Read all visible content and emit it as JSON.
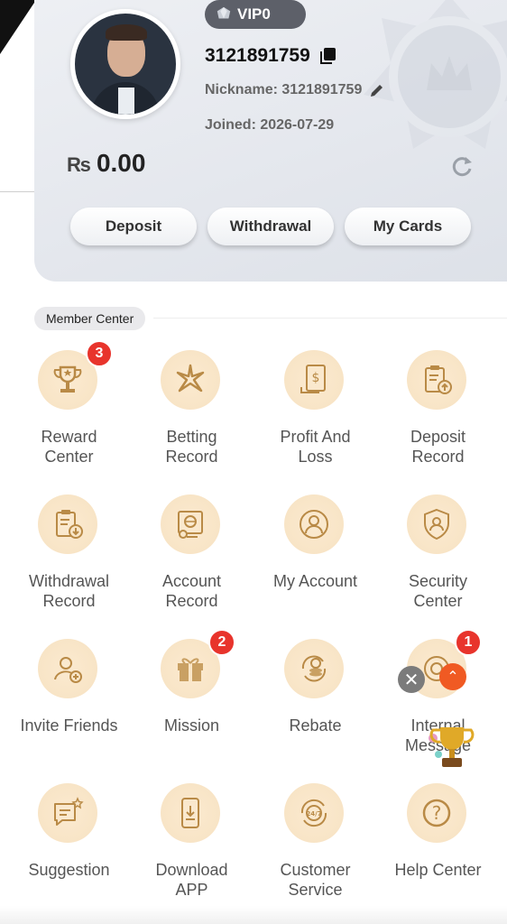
{
  "profile": {
    "vip_label": "VIP0",
    "user_id": "3121891759",
    "nickname": "Nickname: 3121891759",
    "joined": "Joined: 2026-07-29",
    "currency": "₨",
    "balance": "0.00"
  },
  "actions": {
    "deposit": "Deposit",
    "withdrawal": "Withdrawal",
    "my_cards": "My Cards"
  },
  "section": {
    "title": "Member Center"
  },
  "menu": [
    {
      "label": "Reward\nCenter",
      "icon": "trophy-icon",
      "badge": "3"
    },
    {
      "label": "Betting\nRecord",
      "icon": "sparkle-icon",
      "badge": ""
    },
    {
      "label": "Profit And\nLoss",
      "icon": "receipt-dollar-icon",
      "badge": ""
    },
    {
      "label": "Deposit\nRecord",
      "icon": "clipboard-upload-icon",
      "badge": ""
    },
    {
      "label": "Withdrawal\nRecord",
      "icon": "clipboard-download-icon",
      "badge": ""
    },
    {
      "label": "Account\nRecord",
      "icon": "monitor-chart-icon",
      "badge": ""
    },
    {
      "label": "My Account",
      "icon": "user-circle-icon",
      "badge": ""
    },
    {
      "label": "Security\nCenter",
      "icon": "shield-user-icon",
      "badge": ""
    },
    {
      "label": "Invite Friends",
      "icon": "user-add-icon",
      "badge": ""
    },
    {
      "label": "Mission",
      "icon": "gift-icon",
      "badge": "2"
    },
    {
      "label": "Rebate",
      "icon": "coins-cycle-icon",
      "badge": ""
    },
    {
      "label": "Internal\nMessage",
      "icon": "message-icon",
      "badge": "1"
    },
    {
      "label": "Suggestion",
      "icon": "chat-star-icon",
      "badge": ""
    },
    {
      "label": "Download\nAPP",
      "icon": "phone-download-icon",
      "badge": ""
    },
    {
      "label": "Customer\nService",
      "icon": "support-24-7-icon",
      "badge": ""
    },
    {
      "label": "Help Center",
      "icon": "question-circle-icon",
      "badge": ""
    }
  ],
  "floating": {
    "close": "✕",
    "up": "⌃"
  },
  "colors": {
    "accent": "#c9a063",
    "badge": "#e8342c",
    "icon_bg": "#f9e6c8"
  }
}
